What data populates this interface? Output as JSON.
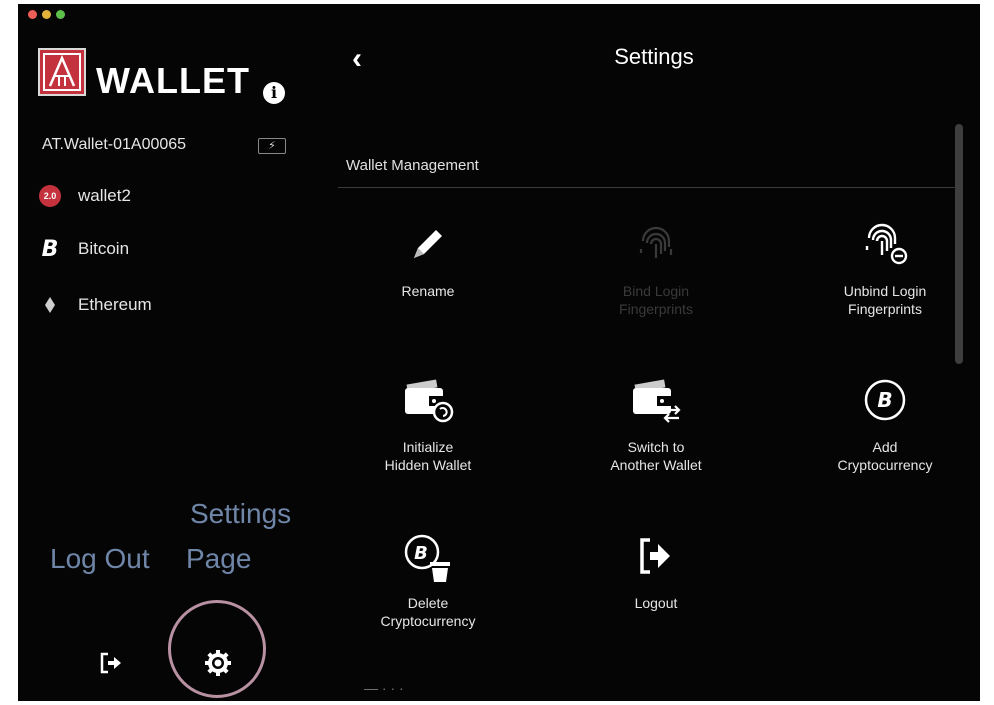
{
  "sidebar": {
    "logo_text": "WALLET",
    "account_name": "AT.Wallet-01A00065",
    "items": [
      {
        "label": "wallet2",
        "badge": "2.0",
        "icon": "wallet2-icon"
      },
      {
        "label": "Bitcoin",
        "icon": "bitcoin-icon"
      },
      {
        "label": "Ethereum",
        "icon": "ethereum-icon"
      }
    ]
  },
  "annotations": {
    "log_out": "Log Out",
    "settings_line1": "Settings",
    "settings_line2": "Page"
  },
  "main": {
    "title": "Settings",
    "section_title": "Wallet Management",
    "tiles": [
      {
        "line1": "Rename",
        "line2": "",
        "icon": "pencil-icon",
        "enabled": true
      },
      {
        "line1": "Bind Login",
        "line2": "Fingerprints",
        "icon": "fingerprint-icon",
        "enabled": false
      },
      {
        "line1": "Unbind Login",
        "line2": "Fingerprints",
        "icon": "fingerprint-unbind-icon",
        "enabled": true
      },
      {
        "line1": "Initialize",
        "line2": "Hidden Wallet",
        "icon": "hidden-wallet-icon",
        "enabled": true
      },
      {
        "line1": "Switch to",
        "line2": "Another Wallet",
        "icon": "switch-wallet-icon",
        "enabled": true
      },
      {
        "line1": "Add",
        "line2": "Cryptocurrency",
        "icon": "add-crypto-icon",
        "enabled": true
      },
      {
        "line1": "Delete",
        "line2": "Cryptocurrency",
        "icon": "delete-crypto-icon",
        "enabled": true
      },
      {
        "line1": "Logout",
        "line2": "",
        "icon": "logout-icon",
        "enabled": true
      }
    ]
  },
  "colors": {
    "background": "#050505",
    "accent_red": "#c4333d",
    "annotation": "#6f86a8",
    "ring": "#b891a2"
  }
}
